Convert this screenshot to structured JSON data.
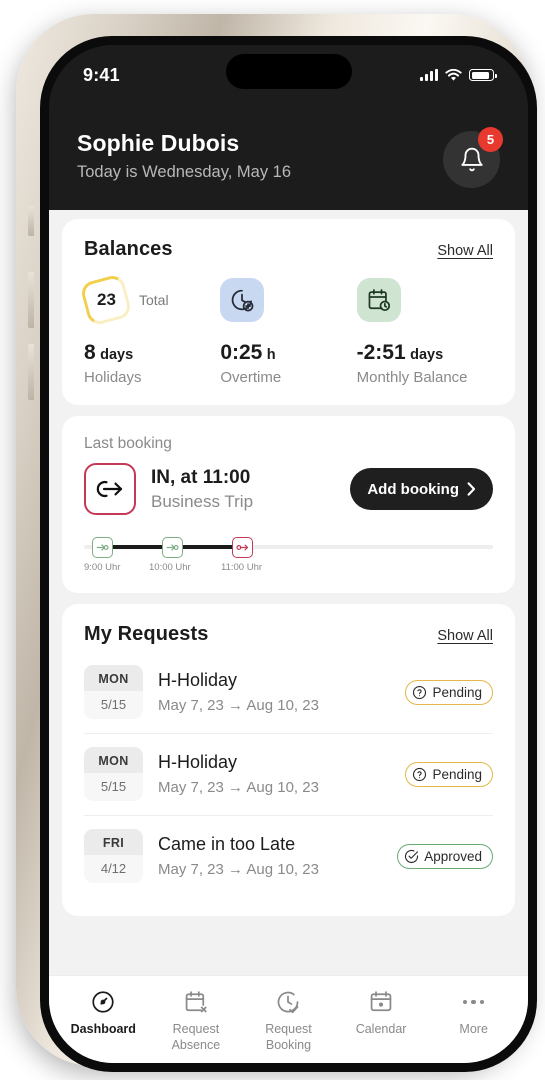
{
  "statusbar": {
    "time": "9:41",
    "signal_icon": "cellular-signal-icon",
    "wifi_icon": "wifi-icon",
    "battery_icon": "battery-icon"
  },
  "header": {
    "name": "Sophie Dubois",
    "subtitle": "Today is Wednesday, May 16",
    "bell_icon": "bell-icon",
    "notification_count": "5",
    "badge_color": "#e8392e",
    "background": "#1c1c1c"
  },
  "balances": {
    "title": "Balances",
    "show_all": "Show All",
    "total": {
      "value": "23",
      "label": "Total",
      "ring_color": "#f2cf4a"
    },
    "overtime_icon": {
      "name": "clock-plus-icon",
      "background": "#c8d8f0"
    },
    "monthly_icon": {
      "name": "calendar-clock-icon",
      "background": "#cfe5d2"
    },
    "metrics": [
      {
        "value": "8",
        "unit": "days",
        "caption": "Holidays"
      },
      {
        "value": "0:25",
        "unit": "h",
        "caption": "Overtime"
      },
      {
        "value": "-2:51",
        "unit": "days",
        "caption": "Monthly Balance"
      }
    ]
  },
  "last_booking": {
    "label": "Last booking",
    "icon": "sign-in-arrow-icon",
    "icon_border_color": "#c43a56",
    "title": "IN, at 11:00",
    "subtitle": "Business Trip",
    "add_button": "Add booking",
    "add_button_chevron": "chevron-right-icon",
    "timeline": [
      {
        "time": "9:00 Uhr",
        "icon": "arrow-in-icon",
        "color": "#7fae86"
      },
      {
        "time": "10:00 Uhr",
        "icon": "arrow-in-icon",
        "color": "#7fae86"
      },
      {
        "time": "11:00 Uhr",
        "icon": "arrow-out-icon",
        "color": "#c43a56"
      }
    ]
  },
  "requests": {
    "title": "My Requests",
    "show_all": "Show All",
    "items": [
      {
        "day": "MON",
        "date": "5/15",
        "title": "H-Holiday",
        "range": "May 7, 23  →  Aug 10, 23",
        "status": "Pending",
        "status_type": "pending",
        "status_icon": "question-circle-icon"
      },
      {
        "day": "MON",
        "date": "5/15",
        "title": "H-Holiday",
        "range": "May 7, 23  →  Aug 10, 23",
        "status": "Pending",
        "status_type": "pending",
        "status_icon": "question-circle-icon"
      },
      {
        "day": "FRI",
        "date": "4/12",
        "title": "Came in too Late",
        "range": "May 7, 23  →  Aug 10, 23",
        "status": "Approved",
        "status_type": "approved",
        "status_icon": "check-circle-icon"
      }
    ]
  },
  "tabbar": {
    "items": [
      {
        "label": "Dashboard",
        "icon": "speedometer-icon",
        "active": true
      },
      {
        "label": "Request\nAbsence",
        "icon": "calendar-x-icon",
        "active": false
      },
      {
        "label": "Request\nBooking",
        "icon": "clock-check-icon",
        "active": false
      },
      {
        "label": "Calendar",
        "icon": "calendar-icon",
        "active": false
      },
      {
        "label": "More",
        "icon": "ellipsis-icon",
        "active": false
      }
    ]
  }
}
